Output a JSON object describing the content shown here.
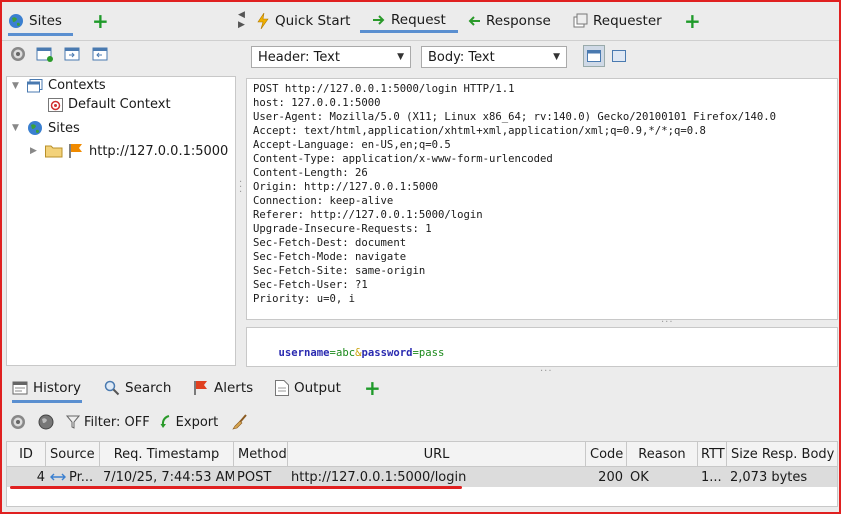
{
  "left_tabs": {
    "sites": "Sites"
  },
  "top_tabs": {
    "quick_start": "Quick Start",
    "request": "Request",
    "response": "Response",
    "requester": "Requester"
  },
  "request_toolbar": {
    "header_select": "Header: Text",
    "body_select": "Body: Text"
  },
  "tree": {
    "contexts": "Contexts",
    "default_context": "Default Context",
    "sites": "Sites",
    "site_url": "http://127.0.0.1:5000"
  },
  "request": {
    "header_lines": [
      "POST http://127.0.0.1:5000/login HTTP/1.1",
      "host: 127.0.0.1:5000",
      "User-Agent: Mozilla/5.0 (X11; Linux x86_64; rv:140.0) Gecko/20100101 Firefox/140.0",
      "Accept: text/html,application/xhtml+xml,application/xml;q=0.9,*/*;q=0.8",
      "Accept-Language: en-US,en;q=0.5",
      "Content-Type: application/x-www-form-urlencoded",
      "Content-Length: 26",
      "Origin: http://127.0.0.1:5000",
      "Connection: keep-alive",
      "Referer: http://127.0.0.1:5000/login",
      "Upgrade-Insecure-Requests: 1",
      "Sec-Fetch-Dest: document",
      "Sec-Fetch-Mode: navigate",
      "Sec-Fetch-Site: same-origin",
      "Sec-Fetch-User: ?1",
      "Priority: u=0, i"
    ],
    "body": {
      "k1": "username",
      "eq1": "=",
      "v1": "abc",
      "amp": "&",
      "k2": "password",
      "eq2": "=",
      "v2": "pass"
    }
  },
  "bottom_tabs": {
    "history": "History",
    "search": "Search",
    "alerts": "Alerts",
    "output": "Output"
  },
  "history_toolbar": {
    "filter": "Filter: OFF",
    "export": "Export"
  },
  "history_table": {
    "columns": [
      "ID",
      "Source",
      "Req. Timestamp",
      "Method",
      "URL",
      "Code",
      "Reason",
      "RTT",
      "Size Resp. Body"
    ],
    "rows": [
      {
        "id": "4",
        "source": "Pr...",
        "timestamp": "7/10/25, 7:44:53 AM",
        "method": "POST",
        "url": "http://127.0.0.1:5000/login",
        "code": "200",
        "reason": "OK",
        "rtt": "1...",
        "size": "2,073 bytes"
      }
    ]
  },
  "colors": {
    "annotation_red": "#e02020",
    "body_key": "#2a2ab0",
    "body_value": "#1c8a1c",
    "accent": "#5a8fd0"
  }
}
